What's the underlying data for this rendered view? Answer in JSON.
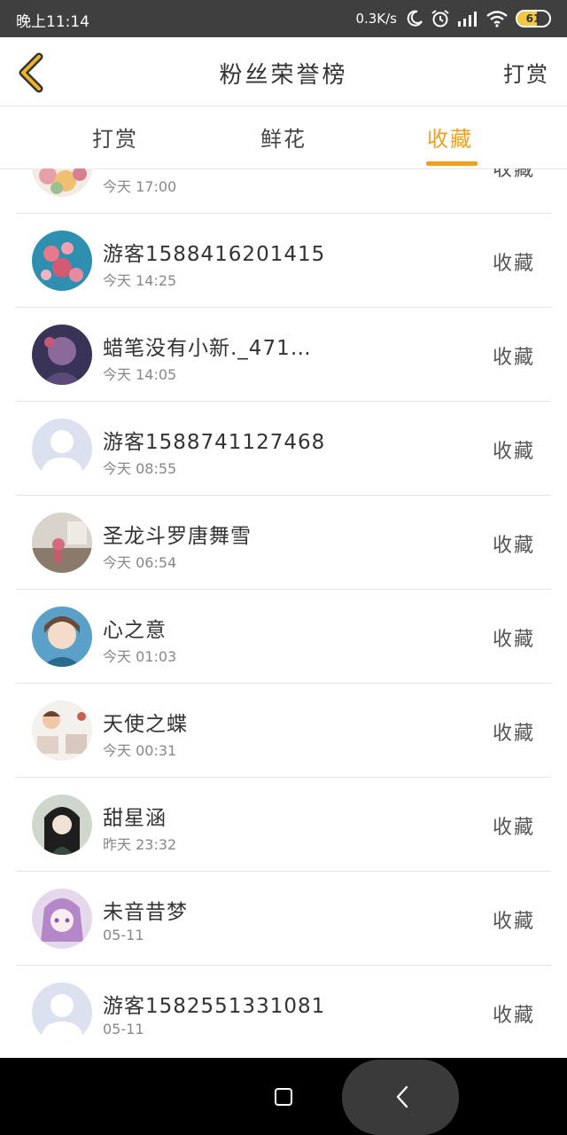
{
  "status_bar": {
    "time": "晚上11:14",
    "net_speed": "0.3K/s",
    "battery": "61",
    "battery_level": 0.61,
    "icons": [
      "moon-icon",
      "alarm-icon",
      "signal-icon",
      "wifi-icon",
      "battery-icon"
    ]
  },
  "header": {
    "back_icon": "chevron-left-icon",
    "title": "粉丝荣誉榜",
    "action": "打赏",
    "accent_color": "#f0a020"
  },
  "tabs": {
    "items": [
      {
        "label": "打赏",
        "active": false
      },
      {
        "label": "鲜花",
        "active": false
      },
      {
        "label": "收藏",
        "active": true
      }
    ]
  },
  "list": {
    "rows": [
      {
        "name": "",
        "time": "今天 17:00",
        "action": "收藏",
        "avatar": "flowers"
      },
      {
        "name": "游客1588416201415",
        "time": "今天 14:25",
        "action": "收藏",
        "avatar": "pink-blossom"
      },
      {
        "name": "蜡笔没有小新._471…",
        "time": "今天 14:05",
        "action": "收藏",
        "avatar": "dark-purple"
      },
      {
        "name": "游客1588741127468",
        "time": "今天 08:55",
        "action": "收藏",
        "avatar": "default"
      },
      {
        "name": "圣龙斗罗唐舞雪",
        "time": "今天 06:54",
        "action": "收藏",
        "avatar": "room"
      },
      {
        "name": "心之意",
        "time": "今天 01:03",
        "action": "收藏",
        "avatar": "anime-girl"
      },
      {
        "name": "天使之蝶",
        "time": "今天 00:31",
        "action": "收藏",
        "avatar": "photo-collage"
      },
      {
        "name": "甜星涵",
        "time": "昨天 23:32",
        "action": "收藏",
        "avatar": "dark-hair"
      },
      {
        "name": "未音昔梦",
        "time": "05-11",
        "action": "收藏",
        "avatar": "purple-anime"
      },
      {
        "name": "游客1582551331081",
        "time": "05-11",
        "action": "收藏",
        "avatar": "default"
      }
    ]
  },
  "nav_bar": {
    "icons": [
      "recents-square-icon",
      "back-arrow-icon"
    ]
  }
}
